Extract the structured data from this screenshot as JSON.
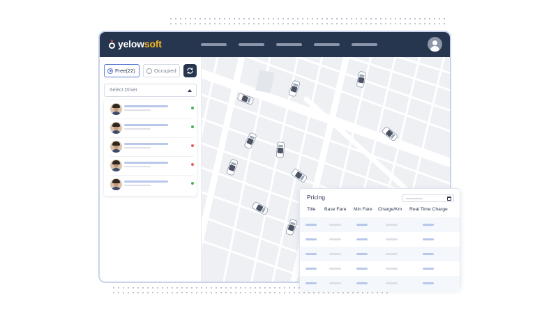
{
  "app": {
    "logo_primary": "yelow",
    "logo_accent": "soft",
    "colors": {
      "topbar": "#27364f",
      "accent": "#f5b51f",
      "online": "#4caf50",
      "offline": "#e85d5d"
    }
  },
  "sidebar": {
    "filter_free": "Free(22)",
    "filter_occupied": "Occupied",
    "select_placeholder": "Select Driver",
    "drivers": [
      {
        "status": "online"
      },
      {
        "status": "online"
      },
      {
        "status": "offline"
      },
      {
        "status": "offline"
      },
      {
        "status": "online"
      }
    ]
  },
  "pricing": {
    "title": "Pricing",
    "columns": [
      "Title",
      "Base Fare",
      "Min Fare",
      "Charge/Km",
      "Real Time Charge"
    ]
  },
  "icons": [
    "user-icon",
    "refresh-icon",
    "chevron-up-icon",
    "calendar-icon",
    "car-icon"
  ]
}
